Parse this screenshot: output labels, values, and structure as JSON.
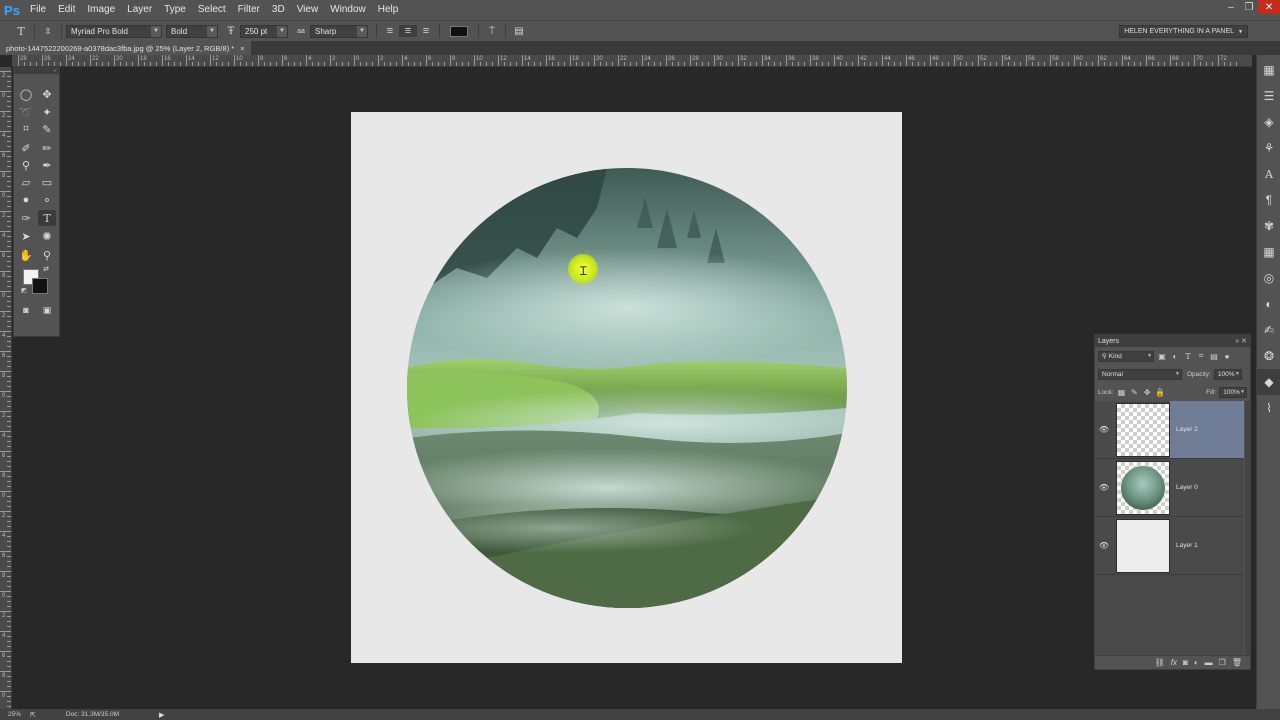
{
  "app": {
    "logo": "Ps",
    "menus": [
      "File",
      "Edit",
      "Image",
      "Layer",
      "Type",
      "Select",
      "Filter",
      "3D",
      "View",
      "Window",
      "Help"
    ],
    "window_controls": {
      "minimize": "‒",
      "restore": "❐",
      "close": "✕"
    }
  },
  "options_bar": {
    "font_family": "Myriad Pro Bold",
    "font_style": "Bold",
    "font_size": "250 pt",
    "anti_alias_icon": "aa",
    "anti_alias": "Sharp",
    "text_color": "#111111",
    "workspace": "HELEN EVERYTHING IN A PANEL"
  },
  "document": {
    "tab_title": "photo-1447522200268-a0378dac3fba.jpg @ 25% (Layer 2, RGB/8) *",
    "tab_close": "×",
    "canvas_color": "#e8e8e8"
  },
  "rulers": {
    "top_labels": [
      "28",
      "26",
      "24",
      "22",
      "20",
      "18",
      "16",
      "14",
      "12",
      "10",
      "8",
      "6",
      "4",
      "2",
      "0",
      "2",
      "4",
      "6",
      "8",
      "10",
      "12",
      "14",
      "16",
      "18",
      "20",
      "22",
      "24",
      "26",
      "28",
      "30",
      "32",
      "34",
      "36",
      "38",
      "40",
      "42",
      "44",
      "46",
      "48",
      "50",
      "52",
      "54",
      "56",
      "58",
      "60",
      "62",
      "64",
      "66",
      "68",
      "70",
      "72"
    ],
    "left_labels": [
      "2",
      "0",
      "2",
      "4",
      "6",
      "8",
      "0",
      "2",
      "4",
      "6",
      "8",
      "0",
      "2",
      "4",
      "6",
      "8",
      "0",
      "2",
      "4",
      "6",
      "8",
      "0",
      "2",
      "4",
      "6",
      "8",
      "0",
      "2",
      "4",
      "6",
      "8",
      "0"
    ]
  },
  "layers_panel": {
    "tab": "Layers",
    "kind": "Kind",
    "blend_mode": "Normal",
    "opacity_label": "Opacity:",
    "opacity": "100%",
    "lock_label": "Lock:",
    "fill_label": "Fill:",
    "fill": "100%",
    "layers": [
      {
        "name": "Layer 2",
        "selected": true,
        "thumb": "transparent"
      },
      {
        "name": "Layer 0",
        "selected": false,
        "thumb": "photo-circle"
      },
      {
        "name": "Layer 1",
        "selected": false,
        "thumb": "white"
      }
    ],
    "selection_color": "#6f7e96"
  },
  "status_bar": {
    "zoom": "25%",
    "doc": "Doc: 31.3M/35.0M"
  }
}
